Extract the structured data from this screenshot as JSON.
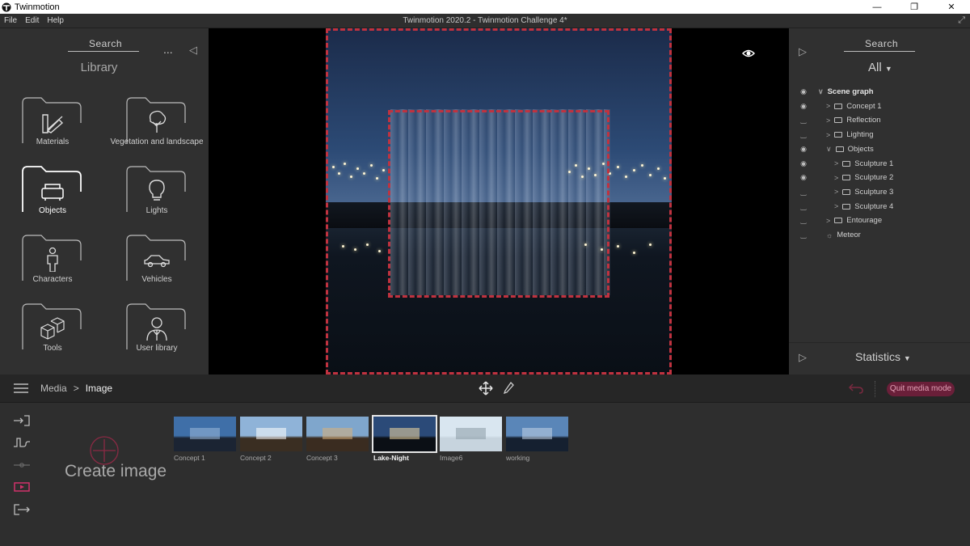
{
  "window": {
    "app_name": "Twinmotion",
    "document_title": "Twinmotion 2020.2 - Twinmotion Challenge 4*",
    "minimize": "—",
    "restore": "❐",
    "close": "✕",
    "resize": "⤢"
  },
  "menu": [
    "File",
    "Edit",
    "Help"
  ],
  "library": {
    "search_label": "Search",
    "title": "Library",
    "more": "...",
    "collapse": "◁",
    "items": [
      {
        "label": "Materials",
        "icon": "material-swatch-icon"
      },
      {
        "label": "Vegetation and landscape",
        "icon": "tree-icon"
      },
      {
        "label": "Objects",
        "icon": "sofa-icon"
      },
      {
        "label": "Lights",
        "icon": "lightbulb-icon"
      },
      {
        "label": "Characters",
        "icon": "person-icon"
      },
      {
        "label": "Vehicles",
        "icon": "car-icon"
      },
      {
        "label": "Tools",
        "icon": "cubes-icon"
      },
      {
        "label": "User library",
        "icon": "user-icon"
      }
    ],
    "selected": "Objects"
  },
  "scene_panel": {
    "expand": "▷",
    "search_label": "Search",
    "filter": "All",
    "tree": [
      {
        "label": "Scene graph",
        "indent": 0,
        "vis": "◉",
        "chev": "∨",
        "folder": false,
        "bold": true
      },
      {
        "label": "Concept 1",
        "indent": 1,
        "vis": "◉",
        "chev": ">",
        "folder": true
      },
      {
        "label": "Reflection",
        "indent": 1,
        "vis": "‿",
        "chev": ">",
        "folder": true
      },
      {
        "label": "Lighting",
        "indent": 1,
        "vis": "‿",
        "chev": ">",
        "folder": true
      },
      {
        "label": "Objects",
        "indent": 1,
        "vis": "◉",
        "chev": "∨",
        "folder": true
      },
      {
        "label": "Sculpture 1",
        "indent": 2,
        "vis": "◉",
        "chev": ">",
        "folder": true
      },
      {
        "label": "Sculpture 2",
        "indent": 2,
        "vis": "◉",
        "chev": ">",
        "folder": true
      },
      {
        "label": "Sculpture 3",
        "indent": 2,
        "vis": "‿",
        "chev": ">",
        "folder": true
      },
      {
        "label": "Sculpture 4",
        "indent": 2,
        "vis": "‿",
        "chev": ">",
        "folder": true
      },
      {
        "label": "Entourage",
        "indent": 1,
        "vis": "‿",
        "chev": ">",
        "folder": true
      },
      {
        "label": "Meteor",
        "indent": 1,
        "vis": "‿",
        "chev": "☼",
        "folder": false
      }
    ],
    "statistics_label": "Statistics"
  },
  "bottom_bar": {
    "breadcrumb_parent": "Media",
    "breadcrumb_separator": ">",
    "breadcrumb_current": "Image",
    "quit_label": "Quit media mode"
  },
  "media": {
    "create_label": "Create image",
    "thumbnails": [
      {
        "label": "Concept 1",
        "selected": false,
        "sky": "#3f6fa8",
        "ground": "#1b2433",
        "glow": "#9bb8d8"
      },
      {
        "label": "Concept 2",
        "selected": false,
        "sky": "#8fb3d8",
        "ground": "#3a2e22",
        "glow": "#ffffff"
      },
      {
        "label": "Concept 3",
        "selected": false,
        "sky": "#7fa6cc",
        "ground": "#3a2c20",
        "glow": "#d8b07a"
      },
      {
        "label": "Lake-Night",
        "selected": true,
        "sky": "#2b4a78",
        "ground": "#0b0f15",
        "glow": "#f2d9a0"
      },
      {
        "label": "Image6",
        "selected": false,
        "sky": "#d9e6f0",
        "ground": "#c7d4de",
        "glow": "#8a9aa6"
      },
      {
        "label": "working",
        "selected": false,
        "sky": "#5a86b8",
        "ground": "#152030",
        "glow": "#c2d4e6"
      }
    ]
  },
  "colors": {
    "accent": "#c0323f",
    "quit_bg": "#6a1f39",
    "panel": "#303030"
  }
}
